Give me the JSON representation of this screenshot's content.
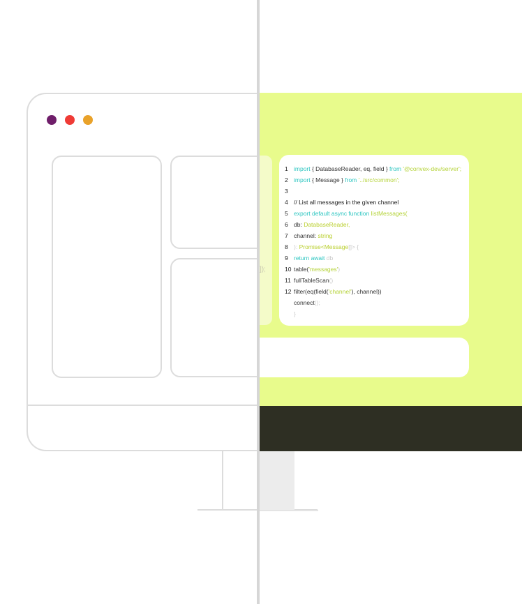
{
  "window_dots": {
    "colors": [
      "#6f1e6a",
      "#ef3b36",
      "#e9a22a"
    ],
    "names": [
      "window-dot-purple",
      "window-dot-red",
      "window-dot-yellow"
    ]
  },
  "palette": {
    "screen_accent": "#e8fb8c",
    "taskbar_dark": "#2e2f23",
    "wireframe_stroke": "#dcdcdc",
    "keyword": "#2bc5c0",
    "string": "#b5d33a"
  },
  "code": {
    "lines": [
      {
        "n": "1",
        "parts": [
          [
            "import",
            "kw"
          ],
          [
            " { DatabaseReader, eq, field } ",
            ""
          ],
          [
            "from",
            "kw"
          ],
          [
            " '@convex-dev/server';",
            "str"
          ]
        ]
      },
      {
        "n": "2",
        "parts": [
          [
            "import",
            "kw"
          ],
          [
            " { Message } ",
            ""
          ],
          [
            "from",
            "kw"
          ],
          [
            " '../src/common';",
            "str"
          ]
        ]
      },
      {
        "n": "3",
        "parts": []
      },
      {
        "n": "4",
        "parts": [
          [
            "// List all messages in the given channel",
            "cm"
          ]
        ]
      },
      {
        "n": "5",
        "parts": [
          [
            "export default async function",
            "kw"
          ],
          [
            " listMessages(",
            "str"
          ]
        ]
      },
      {
        "n": "6",
        "parts": [
          [
            "  db: ",
            ""
          ],
          [
            "DatabaseReader,",
            "ty"
          ]
        ]
      },
      {
        "n": "7",
        "parts": [
          [
            "  channel: ",
            ""
          ],
          [
            "string",
            "ty"
          ]
        ]
      },
      {
        "n": "8",
        "parts": [
          [
            "): ",
            "faint"
          ],
          [
            "Promise<Message",
            "ty"
          ],
          [
            "[]> {",
            "faint"
          ]
        ]
      },
      {
        "n": "9",
        "parts": [
          [
            "  return await",
            "kw"
          ],
          [
            " db",
            "faint"
          ]
        ]
      },
      {
        "n": "10",
        "parts": [
          [
            "    table(",
            ""
          ],
          [
            "'messages'",
            "str"
          ],
          [
            ")",
            "faint"
          ]
        ]
      },
      {
        "n": "11",
        "parts": [
          [
            "    fullTableScan",
            ""
          ],
          [
            "()",
            "faint"
          ]
        ]
      },
      {
        "n": "12",
        "parts": [
          [
            "    filter(eq(field(",
            ""
          ],
          [
            "'channel'",
            "str"
          ],
          [
            "), channel))",
            ""
          ]
        ]
      },
      {
        "n": "",
        "parts": [
          [
            "    connect",
            ""
          ],
          [
            "();",
            "faint"
          ]
        ]
      },
      {
        "n": "",
        "parts": [
          [
            "  }",
            "faint"
          ]
        ]
      }
    ]
  },
  "fragment": {
    "text": "]);"
  }
}
